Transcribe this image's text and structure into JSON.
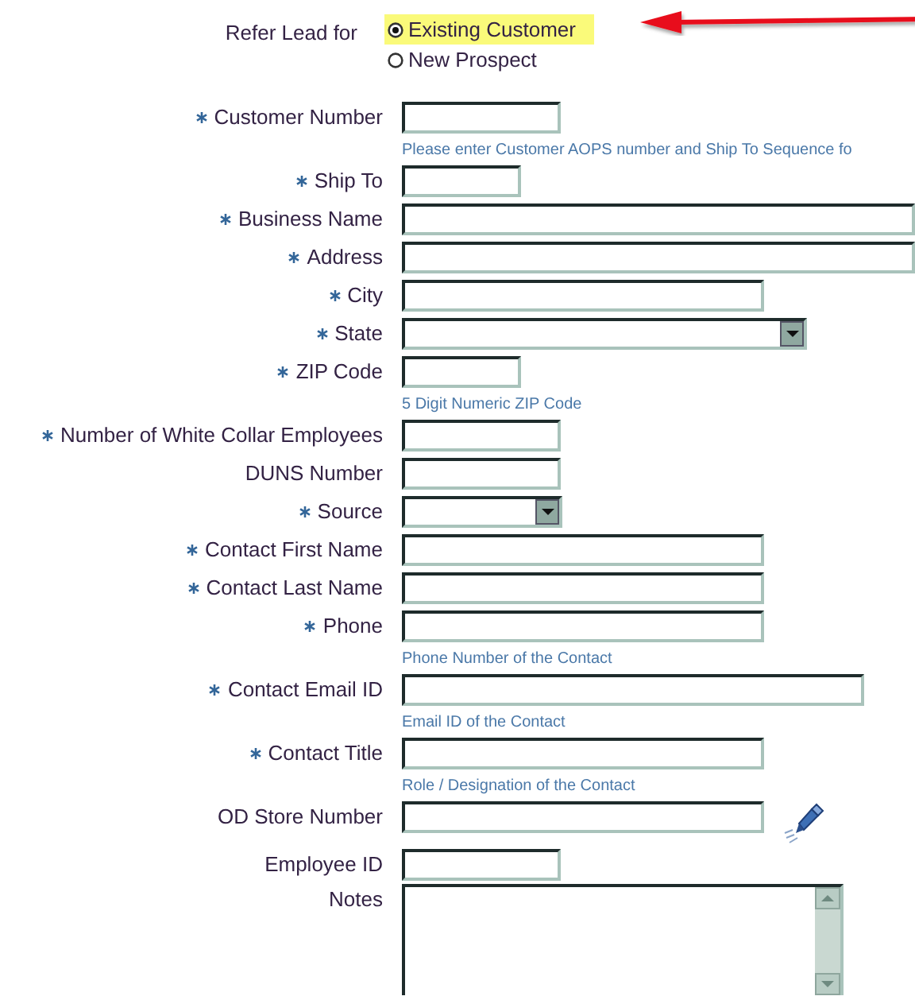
{
  "refer_lead": {
    "label": "Refer Lead for",
    "options": [
      {
        "label": "Existing Customer",
        "selected": true
      },
      {
        "label": "New Prospect",
        "selected": false
      }
    ]
  },
  "fields": [
    {
      "label": "Customer Number",
      "required": true,
      "kind": "text",
      "hint": "Please enter Customer AOPS number and Ship To Sequence fo"
    },
    {
      "label": "Ship To",
      "required": true,
      "kind": "text"
    },
    {
      "label": "Business Name",
      "required": true,
      "kind": "text"
    },
    {
      "label": "Address",
      "required": true,
      "kind": "text"
    },
    {
      "label": "City",
      "required": true,
      "kind": "text"
    },
    {
      "label": "State",
      "required": true,
      "kind": "select"
    },
    {
      "label": "ZIP Code",
      "required": true,
      "kind": "text",
      "hint": "5 Digit Numeric ZIP Code"
    },
    {
      "label": "Number of White Collar Employees",
      "required": true,
      "kind": "text"
    },
    {
      "label": "DUNS Number",
      "required": false,
      "kind": "text"
    },
    {
      "label": "Source",
      "required": true,
      "kind": "select"
    },
    {
      "label": "Contact First Name",
      "required": true,
      "kind": "text"
    },
    {
      "label": "Contact Last Name",
      "required": true,
      "kind": "text"
    },
    {
      "label": "Phone",
      "required": true,
      "kind": "text",
      "hint": "Phone Number of the Contact"
    },
    {
      "label": "Contact Email ID",
      "required": true,
      "kind": "text",
      "hint": "Email ID of the Contact"
    },
    {
      "label": "Contact Title",
      "required": true,
      "kind": "text",
      "hint": "Role / Designation of the Contact"
    },
    {
      "label": "OD Store Number",
      "required": false,
      "kind": "lookup"
    },
    {
      "label": "Employee ID",
      "required": false,
      "kind": "text"
    },
    {
      "label": "Notes",
      "required": false,
      "kind": "textarea"
    }
  ]
}
